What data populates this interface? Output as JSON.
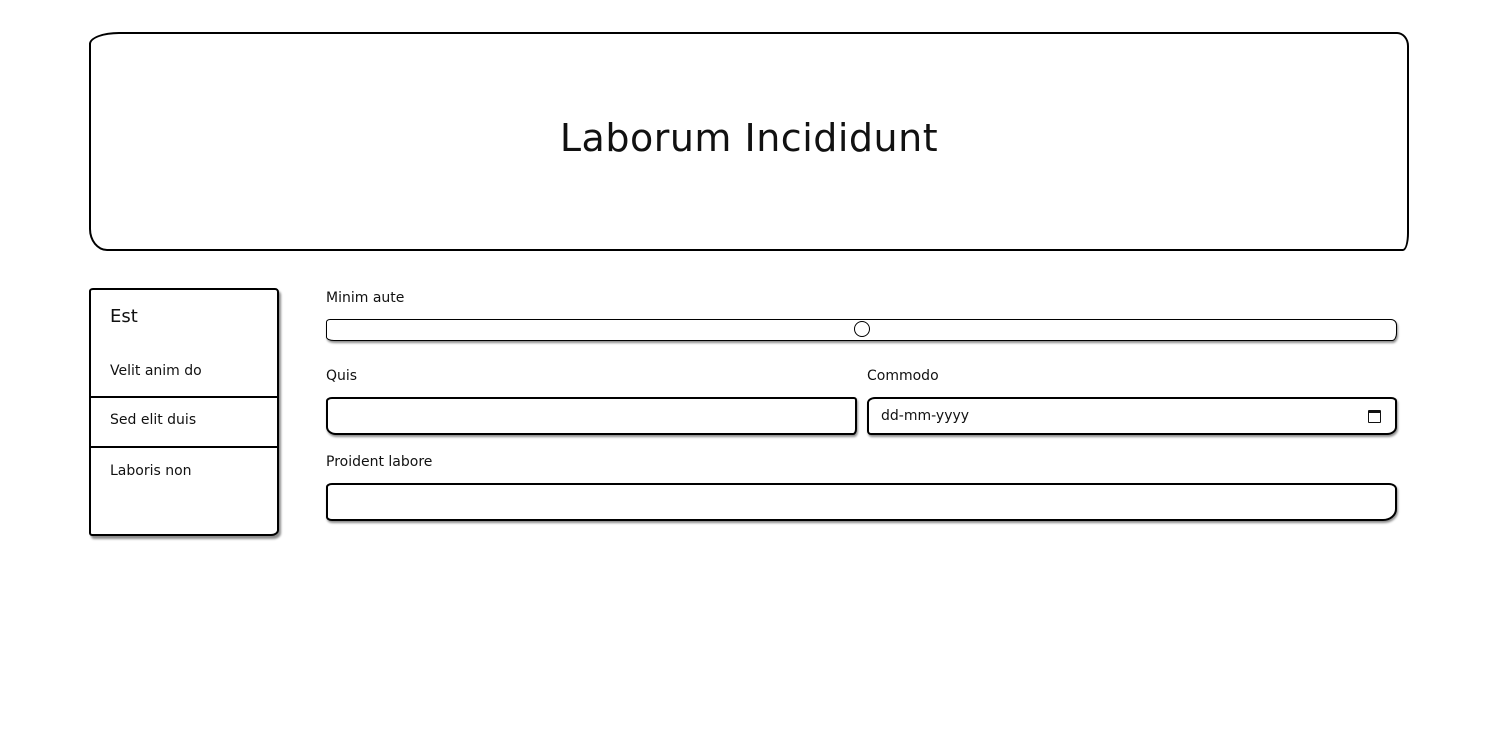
{
  "header": {
    "title": "Laborum Incididunt"
  },
  "sidebar": {
    "title": "Est",
    "items": [
      {
        "label": "Velit anim do"
      },
      {
        "label": "Sed elit duis"
      },
      {
        "label": "Laboris non"
      }
    ]
  },
  "form": {
    "slider": {
      "label": "Minim aute",
      "value_fraction": 0.5
    },
    "quis": {
      "label": "Quis",
      "value": ""
    },
    "commodo": {
      "label": "Commodo",
      "placeholder": "dd-mm-yyyy",
      "icon": "calendar-icon"
    },
    "proident": {
      "label": "Proident labore",
      "value": ""
    }
  }
}
